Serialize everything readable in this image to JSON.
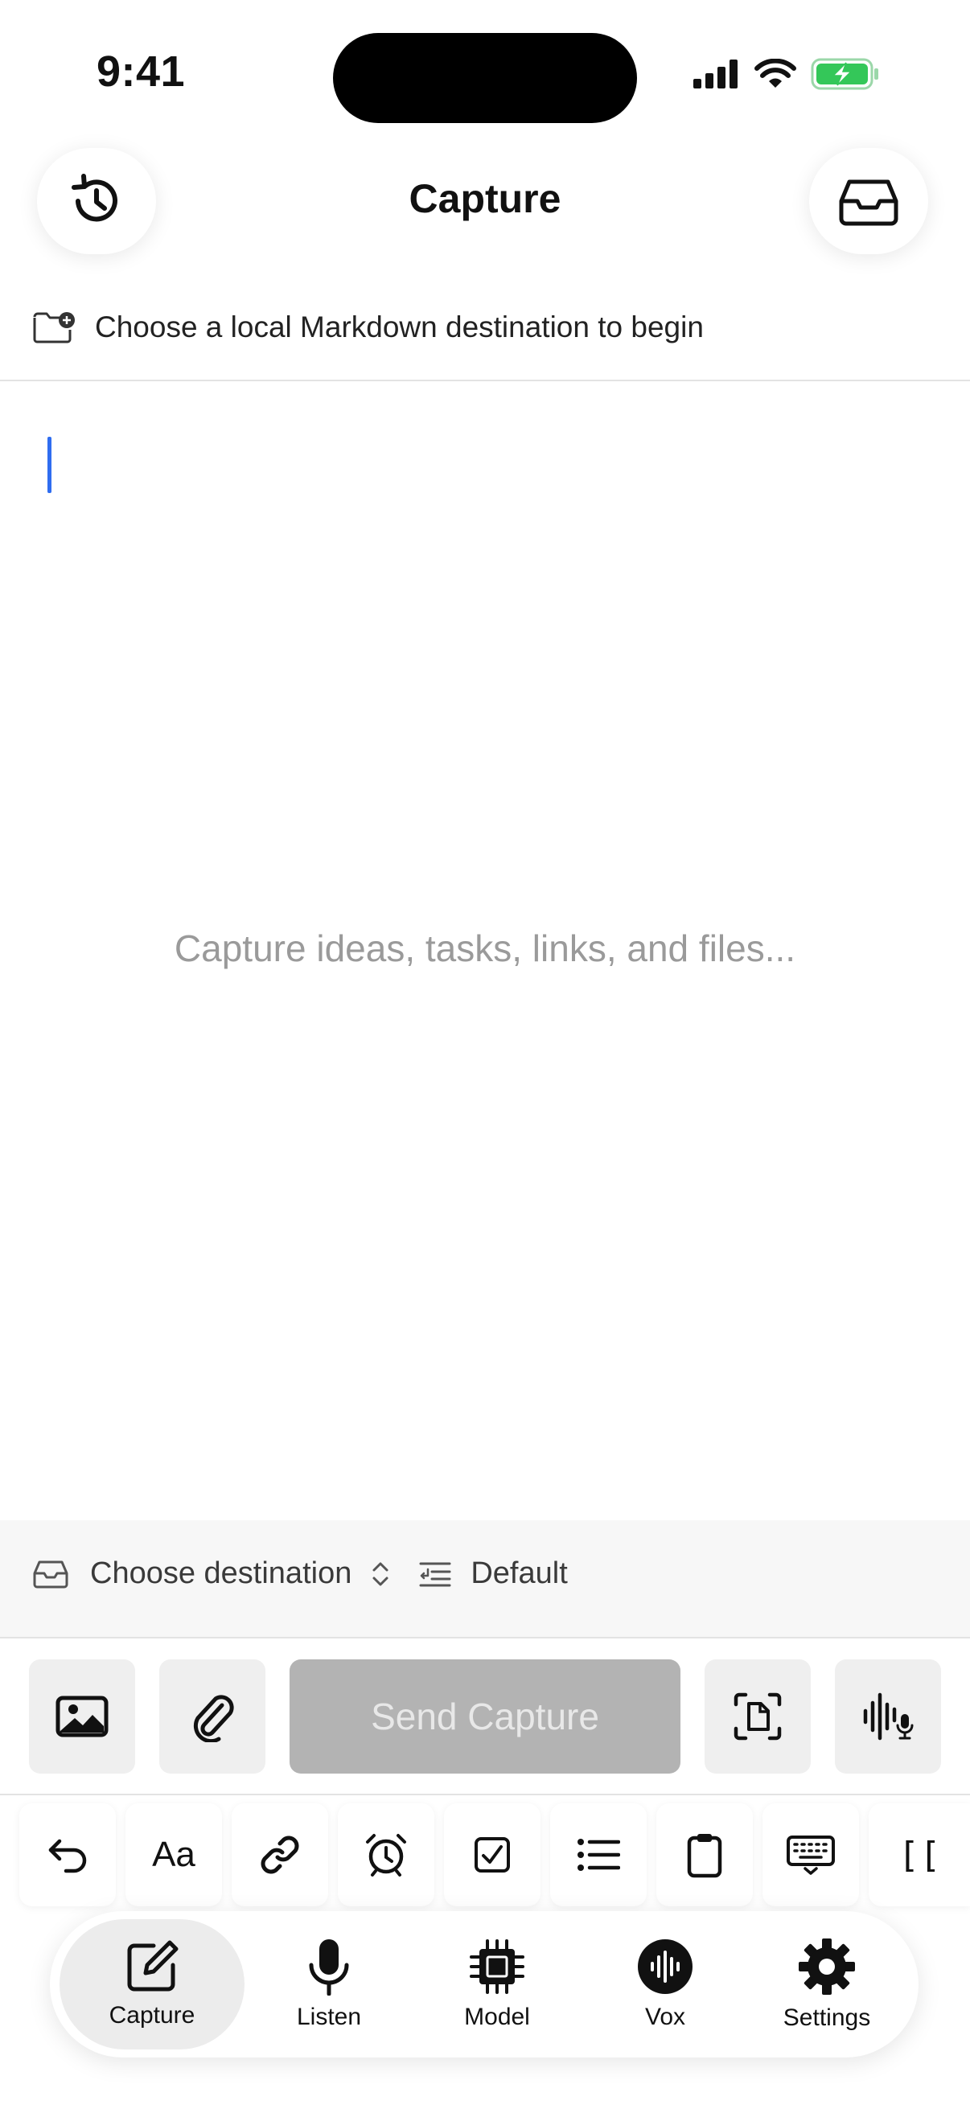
{
  "status": {
    "time": "9:41"
  },
  "header": {
    "title": "Capture",
    "history_icon": "history-icon",
    "inbox_icon": "inbox-icon"
  },
  "banner": {
    "text": "Choose a local Markdown destination to begin",
    "icon": "folder-plus-icon"
  },
  "editor": {
    "placeholder": "Capture ideas, tasks, links, and files..."
  },
  "destination": {
    "label": "Choose destination",
    "format": "Default"
  },
  "actions": {
    "send_label": "Send Capture"
  },
  "keyboard_toolbar": {
    "font_label": "Aa",
    "wiki_label": "[["
  },
  "tabs": [
    {
      "label": "Capture",
      "icon": "compose-icon"
    },
    {
      "label": "Listen",
      "icon": "microphone-icon"
    },
    {
      "label": "Model",
      "icon": "chip-icon"
    },
    {
      "label": "Vox",
      "icon": "waveform-icon"
    },
    {
      "label": "Settings",
      "icon": "gear-icon"
    }
  ],
  "colors": {
    "accent_caret": "#2f6df0",
    "battery": "#34c759",
    "send_disabled": "#b3b3b3"
  }
}
